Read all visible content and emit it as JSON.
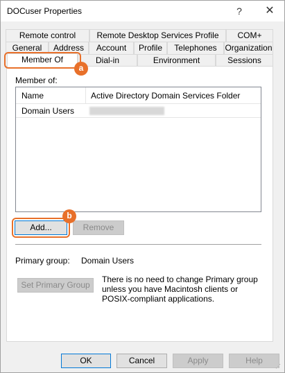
{
  "window": {
    "title": "DOCuser Properties",
    "help_glyph": "?",
    "close_glyph": "✕"
  },
  "tabs": {
    "row1": [
      "Remote control",
      "Remote Desktop Services Profile",
      "COM+"
    ],
    "row2": [
      "General",
      "Address",
      "Account",
      "Profile",
      "Telephones",
      "Organization"
    ],
    "row3": [
      "Member Of",
      "Dial-in",
      "Environment",
      "Sessions"
    ],
    "active": "Member Of"
  },
  "member_of": {
    "label": "Member of:",
    "columns": [
      "Name",
      "Active Directory Domain Services Folder"
    ],
    "rows": [
      {
        "name": "Domain Users",
        "folder": ""
      }
    ]
  },
  "buttons": {
    "add": "Add...",
    "remove": "Remove",
    "set_primary": "Set Primary Group",
    "ok": "OK",
    "cancel": "Cancel",
    "apply": "Apply",
    "help": "Help"
  },
  "primary_group": {
    "label": "Primary group:",
    "value": "Domain Users",
    "note": "There is no need to change Primary group unless you have Macintosh clients or POSIX-compliant applications."
  },
  "annotations": {
    "a": "a",
    "b": "b",
    "color": "#e8702a"
  }
}
